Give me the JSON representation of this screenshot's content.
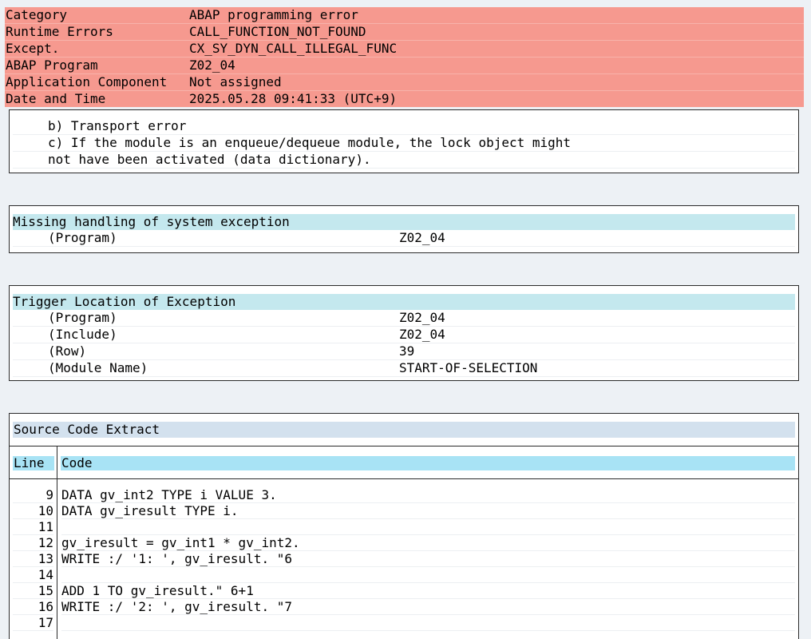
{
  "header": [
    {
      "label": "Category",
      "value": "ABAP programming error"
    },
    {
      "label": "Runtime Errors",
      "value": "CALL_FUNCTION_NOT_FOUND"
    },
    {
      "label": "Except.",
      "value": "CX_SY_DYN_CALL_ILLEGAL_FUNC"
    },
    {
      "label": "ABAP Program",
      "value": "Z02_04"
    },
    {
      "label": "Application Component",
      "value": "Not assigned"
    },
    {
      "label": "Date and Time",
      "value": "2025.05.28 09:41:33 (UTC+9)"
    }
  ],
  "description": {
    "lines": [
      "b) Transport error",
      "c) If the module is an enqueue/dequeue module, the lock object might",
      "not have been activated (data dictionary)."
    ]
  },
  "missing": {
    "title": "Missing handling of system exception",
    "rows": [
      {
        "label": "(Program)",
        "value": "Z02_04"
      }
    ]
  },
  "trigger": {
    "title": "Trigger Location of Exception",
    "rows": [
      {
        "label": "(Program)",
        "value": "Z02_04"
      },
      {
        "label": "(Include)",
        "value": "Z02_04"
      },
      {
        "label": "(Row)",
        "value": "39"
      },
      {
        "label": "(Module Name)",
        "value": "START-OF-SELECTION"
      }
    ]
  },
  "source": {
    "title": "Source Code Extract",
    "col_line": "Line",
    "col_code": "Code",
    "rows": [
      {
        "line": "9",
        "code": "DATA gv_int2 TYPE i VALUE 3."
      },
      {
        "line": "10",
        "code": "DATA gv_iresult TYPE i."
      },
      {
        "line": "11",
        "code": ""
      },
      {
        "line": "12",
        "code": "gv_iresult = gv_int1 * gv_int2."
      },
      {
        "line": "13",
        "code": "WRITE :/ '1: ', gv_iresult. \"6"
      },
      {
        "line": "14",
        "code": ""
      },
      {
        "line": "15",
        "code": "ADD 1 TO gv_iresult.\" 6+1"
      },
      {
        "line": "16",
        "code": "WRITE :/ '2: ', gv_iresult. \"7"
      },
      {
        "line": "17",
        "code": ""
      }
    ]
  }
}
